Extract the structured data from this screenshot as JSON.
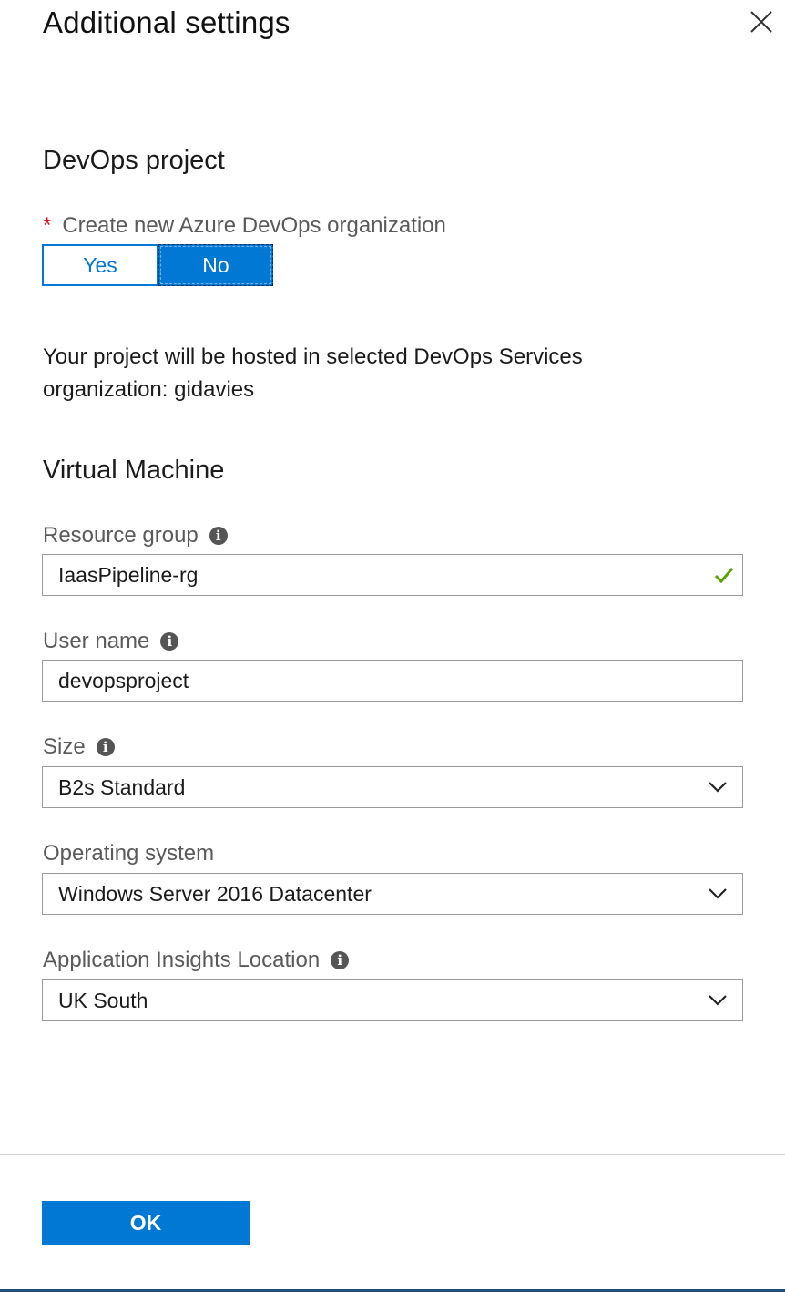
{
  "panel": {
    "title": "Additional settings",
    "close_icon": "close-icon"
  },
  "devops": {
    "section_title": "DevOps project",
    "create_org_label": "Create new Azure DevOps organization",
    "required_marker": "*",
    "toggle": {
      "yes_label": "Yes",
      "no_label": "No",
      "selected": "No"
    },
    "hosted_info": "Your project will be hosted in selected DevOps Services organization: gidavies"
  },
  "vm": {
    "section_title": "Virtual Machine",
    "resource_group": {
      "label": "Resource group",
      "value": "IaasPipeline-rg",
      "status_icon": "check-icon",
      "status_color": "#57a300"
    },
    "user_name": {
      "label": "User name",
      "value": "devopsproject"
    },
    "size": {
      "label": "Size",
      "value": "B2s Standard"
    },
    "operating_system": {
      "label": "Operating system",
      "value": "Windows Server 2016 Datacenter"
    },
    "app_insights_location": {
      "label": "Application Insights Location",
      "value": "UK South"
    }
  },
  "footer": {
    "ok_label": "OK"
  },
  "colors": {
    "accent": "#0078d4",
    "required": "#e00b1c",
    "valid": "#57a300"
  }
}
